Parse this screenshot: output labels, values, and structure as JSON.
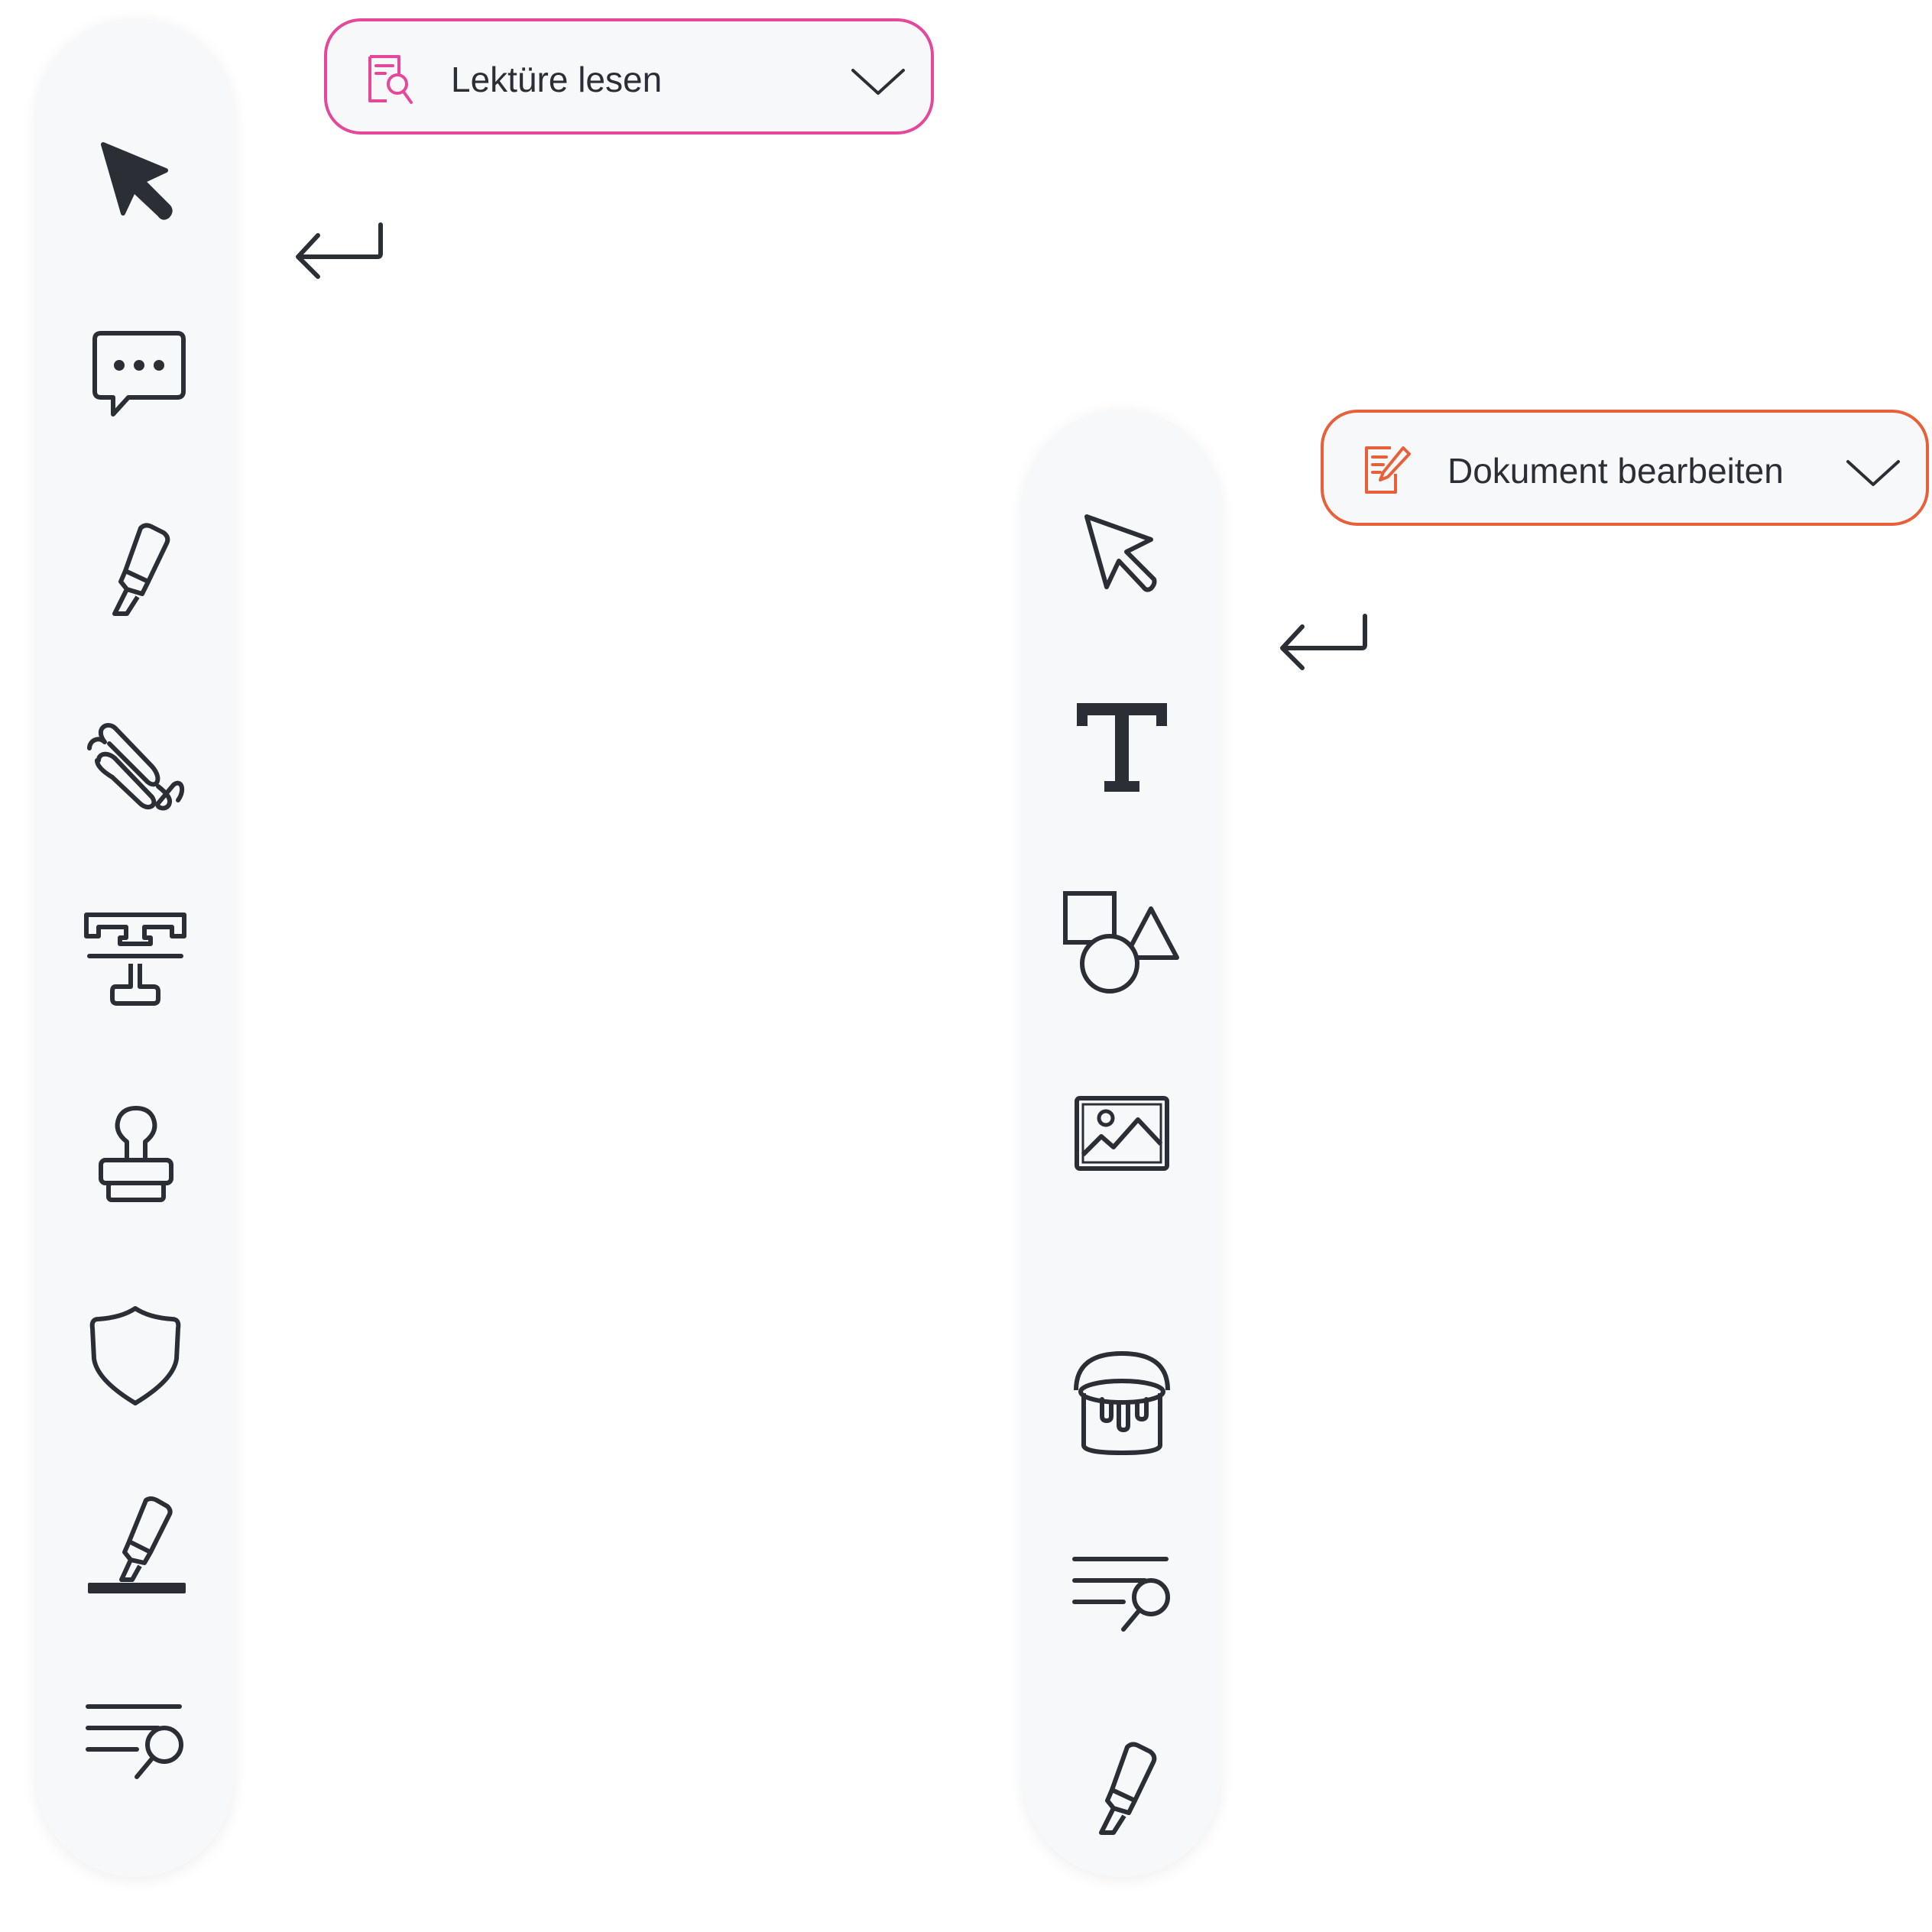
{
  "mode_selectors": {
    "read": {
      "label": "Lektüre lesen",
      "accent": "#e5489b",
      "icon": "document-search-icon",
      "chevron": "chevron-down-icon"
    },
    "edit": {
      "label": "Dokument bearbeiten",
      "accent": "#e8603a",
      "icon": "document-edit-icon",
      "chevron": "chevron-down-icon"
    }
  },
  "return_icon": "enter-arrow-icon",
  "toolbars": {
    "read": {
      "tools": [
        "cursor-filled-icon",
        "comment-icon",
        "highlighter-icon",
        "freehand-scribble-icon",
        "text-stamp-icon",
        "stamp-icon",
        "shield-icon",
        "underline-highlighter-icon",
        "text-search-icon"
      ]
    },
    "edit": {
      "tools": [
        "cursor-outline-icon",
        "text-icon",
        "shapes-icon",
        "image-icon",
        "paint-bucket-icon",
        "text-search-icon",
        "highlighter-icon"
      ]
    }
  },
  "colors": {
    "icon": "#2b2e35",
    "toolbar_bg": "#f7f8fa"
  }
}
